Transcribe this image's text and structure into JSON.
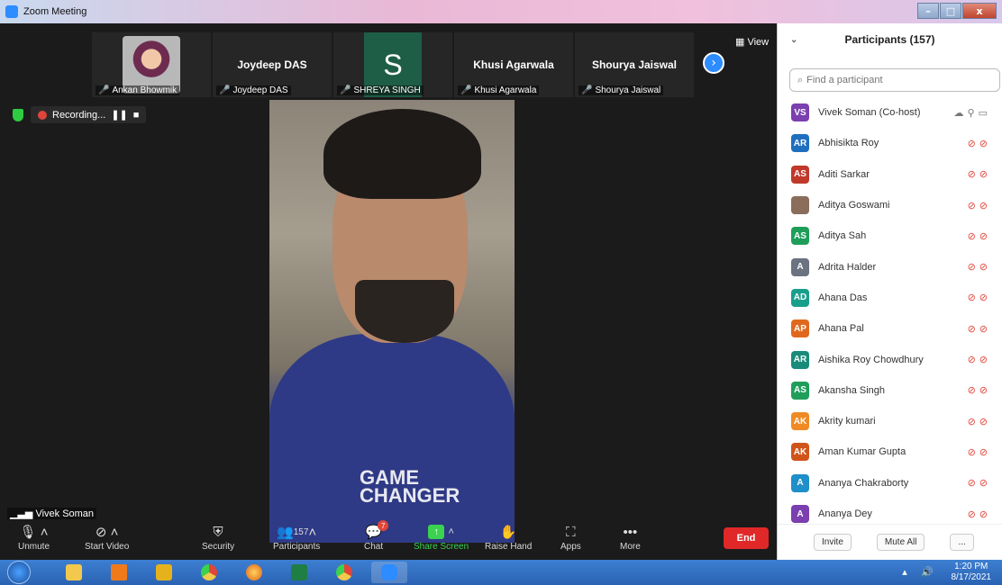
{
  "window": {
    "title": "Zoom Meeting"
  },
  "strip": {
    "tiles": [
      {
        "display": "",
        "label": "Ankan Bhowmik"
      },
      {
        "display": "Joydeep DAS",
        "label": "Joydeep DAS"
      },
      {
        "display": "S",
        "label": "SHREYA SINGH"
      },
      {
        "display": "Khusi Agarwala",
        "label": "Khusi Agarwala"
      },
      {
        "display": "Shourya Jaiswal",
        "label": "Shourya Jaiswal"
      }
    ],
    "view_label": "View"
  },
  "recording": {
    "label": "Recording..."
  },
  "main_video": {
    "speaker": "Vivek Soman",
    "shirt_text": "GAME CHANGER"
  },
  "toolbar": {
    "unmute": "Unmute",
    "start_video": "Start Video",
    "security": "Security",
    "participants": "Participants",
    "participants_count": "157",
    "chat": "Chat",
    "chat_badge": "7",
    "share_screen": "Share Screen",
    "raise_hand": "Raise Hand",
    "apps": "Apps",
    "more": "More",
    "end": "End"
  },
  "panel": {
    "title": "Participants (157)",
    "search_placeholder": "Find a participant",
    "participants": [
      {
        "initials": "VS",
        "name": "Vivek Soman (Co-host)",
        "color": "#7b3fb0"
      },
      {
        "initials": "AR",
        "name": "Abhisikta Roy",
        "color": "#1f6fbf"
      },
      {
        "initials": "AS",
        "name": "Aditi Sarkar",
        "color": "#c0392b"
      },
      {
        "initials": "",
        "name": "Aditya Goswami",
        "color": "#8a6d5a"
      },
      {
        "initials": "AS",
        "name": "Aditya Sah",
        "color": "#1f9e5a"
      },
      {
        "initials": "A",
        "name": "Adrita Halder",
        "color": "#6b7280"
      },
      {
        "initials": "AD",
        "name": "Ahana Das",
        "color": "#1a9e8c"
      },
      {
        "initials": "AP",
        "name": "Ahana Pal",
        "color": "#e0681e"
      },
      {
        "initials": "AR",
        "name": "Aishika Roy Chowdhury",
        "color": "#1a8a7a"
      },
      {
        "initials": "AS",
        "name": "Akansha Singh",
        "color": "#1f9e5a"
      },
      {
        "initials": "AK",
        "name": "Akrity kumari",
        "color": "#f08a24"
      },
      {
        "initials": "AK",
        "name": "Aman Kumar Gupta",
        "color": "#d0541a"
      },
      {
        "initials": "A",
        "name": "Ananya Chakraborty",
        "color": "#1f8fc9"
      },
      {
        "initials": "A",
        "name": "Ananya Dey",
        "color": "#7b3fb0"
      }
    ],
    "invite": "Invite",
    "mute_all": "Mute All",
    "more": "..."
  },
  "taskbar": {
    "time": "1:20 PM",
    "date": "8/17/2021"
  }
}
